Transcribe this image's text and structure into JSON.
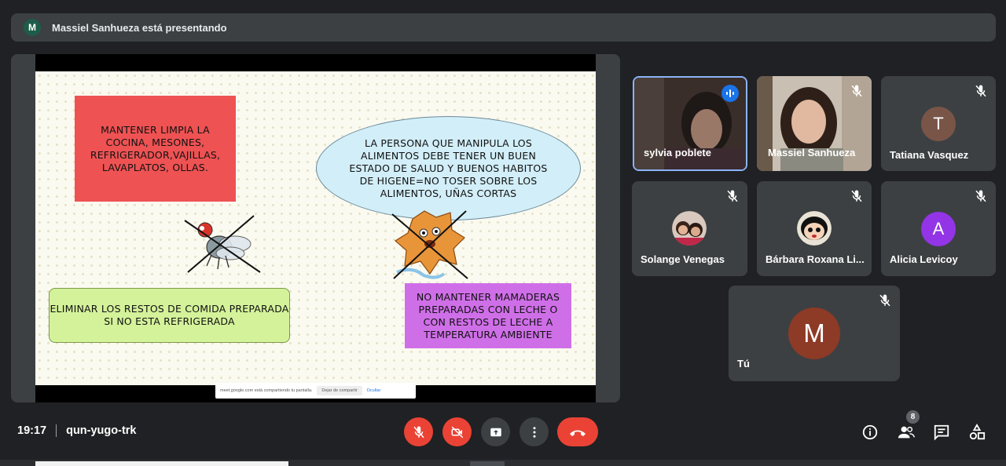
{
  "presenter_bar": {
    "avatar_letter": "M",
    "text": "Massiel Sanhueza está presentando"
  },
  "slide": {
    "red_box": "MANTENER LIMPIA LA COCINA, MESONES, REFRIGERADOR,VAJILLAS, LAVAPLATOS, OLLAS.",
    "bubble": "LA PERSONA QUE MANIPULA LOS ALIMENTOS DEBE TENER UN BUEN ESTADO DE SALUD Y BUENOS HABITOS DE HIGENE=NO TOSER SOBRE LOS ALIMENTOS, UÑAS CORTAS",
    "green_box": "ELIMINAR LOS RESTOS DE COMIDA PREPARADA SI NO ESTA REFRIGERADA",
    "purple_box": "NO MANTENER MAMADERAS PREPARADAS CON LECHE O CON RESTOS DE LECHE A TEMPERATURA AMBIENTE"
  },
  "share_notice": {
    "text": "meet.google.com está compartiendo tu pantalla.",
    "stop": "Dejar de compartir",
    "hide": "Ocultar"
  },
  "participants": [
    {
      "name": "sylvia poblete",
      "speaking": true
    },
    {
      "name": "Massiel Sanhueza",
      "muted": true
    },
    {
      "name": "Tatiana Vasquez",
      "avatar_letter": "T",
      "avatar_color": "#795548",
      "muted": true
    },
    {
      "name": "Solange Venegas",
      "muted": true
    },
    {
      "name": "Bárbara Roxana Li...",
      "muted": true
    },
    {
      "name": "Alicia Levicoy",
      "avatar_letter": "A",
      "avatar_color": "#9334e6",
      "muted": true
    },
    {
      "name": "Tú",
      "avatar_letter": "M",
      "avatar_color": "#8d3a26",
      "muted": true
    }
  ],
  "bottom": {
    "time": "19:17",
    "meeting_code": "qun-yugo-trk",
    "people_count": "8"
  },
  "colors": {
    "end_call": "#ea4335",
    "background": "#202124",
    "tile": "#3c4043",
    "accent": "#1a73e8"
  }
}
